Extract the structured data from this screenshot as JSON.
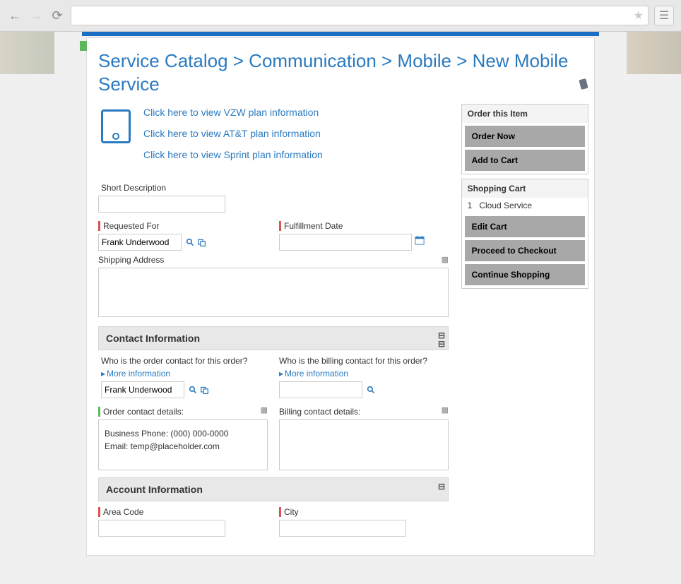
{
  "breadcrumb": "Service Catalog > Communication > Mobile > New Mobile Service",
  "planLinks": {
    "vzw": "Click here to view VZW plan information",
    "att": "Click here to view AT&T plan information",
    "sprint": "Click here to view Sprint plan information"
  },
  "labels": {
    "shortDesc": "Short Description",
    "requestedFor": "Requested For",
    "fulfillmentDate": "Fulfillment Date",
    "shippingAddress": "Shipping Address",
    "contactInfo": "Contact Information",
    "orderContactQ": "Who is the order contact for this order?",
    "billingContactQ": "Who is the billing contact for this order?",
    "moreInfo": "More information",
    "orderContactDetails": "Order contact details:",
    "billingContactDetails": "Billing contact details:",
    "accountInfo": "Account Information",
    "areaCode": "Area Code",
    "city": "City"
  },
  "values": {
    "shortDesc": "",
    "requestedFor": "Frank Underwood",
    "fulfillmentDate": "",
    "shippingAddress": "",
    "orderContact": "Frank Underwood",
    "billingContact": "",
    "orderDetailsPhone": "Business Phone: (000) 000-0000",
    "orderDetailsEmail": "Email: temp@placeholder.com",
    "areaCode": "",
    "city": ""
  },
  "sidebar": {
    "orderItemHead": "Order this Item",
    "orderNow": "Order Now",
    "addToCart": "Add to Cart",
    "shoppingCartHead": "Shopping Cart",
    "cartQty": "1",
    "cartItem": "Cloud Service",
    "editCart": "Edit Cart",
    "proceed": "Proceed to Checkout",
    "continue": "Continue Shopping"
  }
}
